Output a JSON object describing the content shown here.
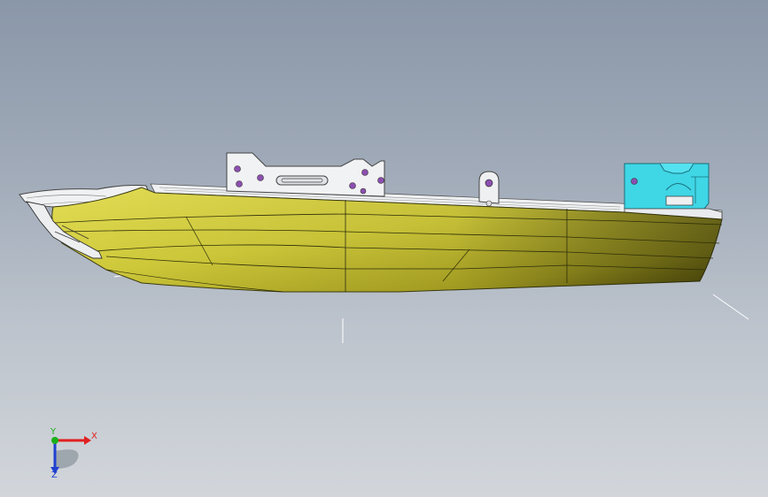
{
  "viewport": {
    "model": "hull",
    "colors": {
      "background_top": "#8a97a8",
      "background_bottom": "#d2d6db",
      "hull_body": "#cfc93a",
      "hull_shadow": "#7b7410",
      "deck_parts": "#e9ebee",
      "cyan_block": "#3fd6e6",
      "hole_marks": "#8c4fb0"
    }
  },
  "triad": {
    "x_label": "X",
    "y_label": "Y",
    "z_label": "Z",
    "colors": {
      "x": "#e02020",
      "y": "#19b019",
      "z": "#2040d0"
    }
  }
}
